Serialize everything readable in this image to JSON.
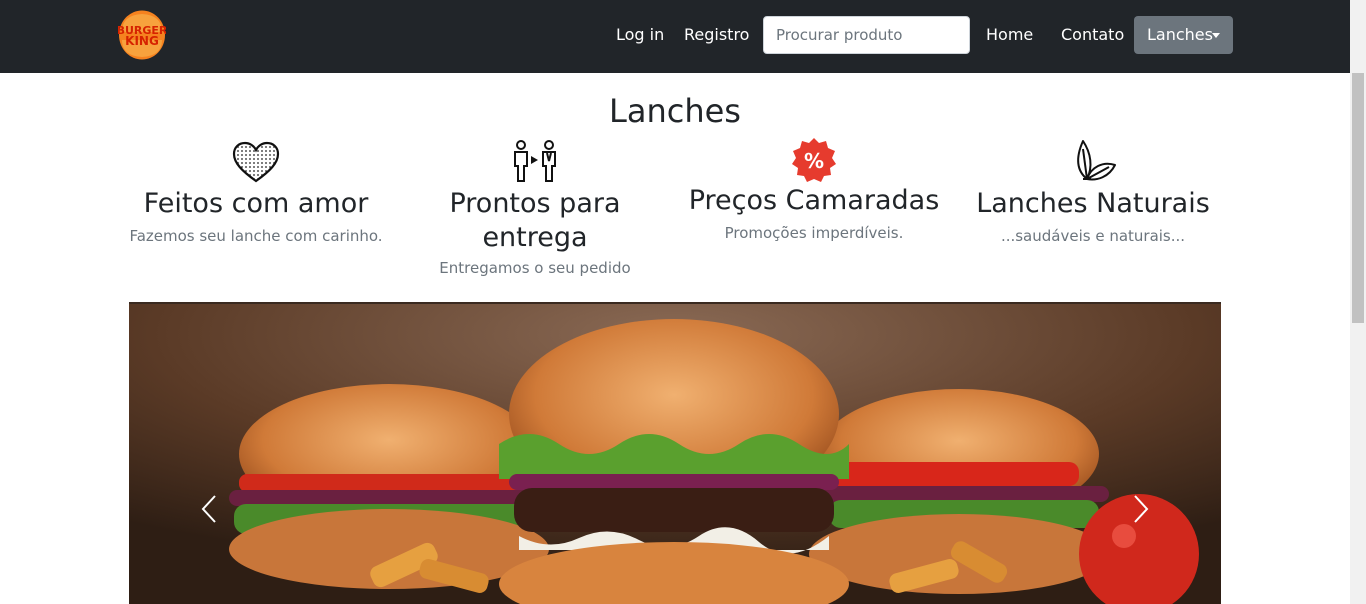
{
  "navbar": {
    "brand_logo": {
      "icon": "burger-king-logo-icon",
      "text_top": "BURGER",
      "text_bottom": "KING"
    },
    "links": {
      "login": "Log in",
      "register": "Registro",
      "home": "Home",
      "contact": "Contato"
    },
    "search": {
      "placeholder": "Procurar produto",
      "value": ""
    },
    "dropdown": {
      "label": "Lanches"
    }
  },
  "main": {
    "title": "Lanches",
    "features": [
      {
        "icon": "heart-icon",
        "title": "Feitos com amor",
        "text": "Fazemos seu lanche com carinho."
      },
      {
        "icon": "delivery-people-icon",
        "title": "Prontos para entrega",
        "text": "Entregamos o seu pedido"
      },
      {
        "icon": "discount-badge-icon",
        "title": "Preços Camaradas",
        "text": "Promoções imperdíveis."
      },
      {
        "icon": "leaf-icon",
        "title": "Lanches Naturais",
        "text": "...saudáveis e naturais..."
      }
    ],
    "carousel": {
      "image": "burgers-with-fries-image",
      "prev_icon": "chevron-left-icon",
      "next_icon": "chevron-right-icon"
    }
  },
  "colors": {
    "navbar_bg": "#212529",
    "dropdown_bg": "#6c757d",
    "discount_red": "#e63b2e",
    "logo_orange": "#f5821f",
    "logo_red": "#d62300"
  }
}
